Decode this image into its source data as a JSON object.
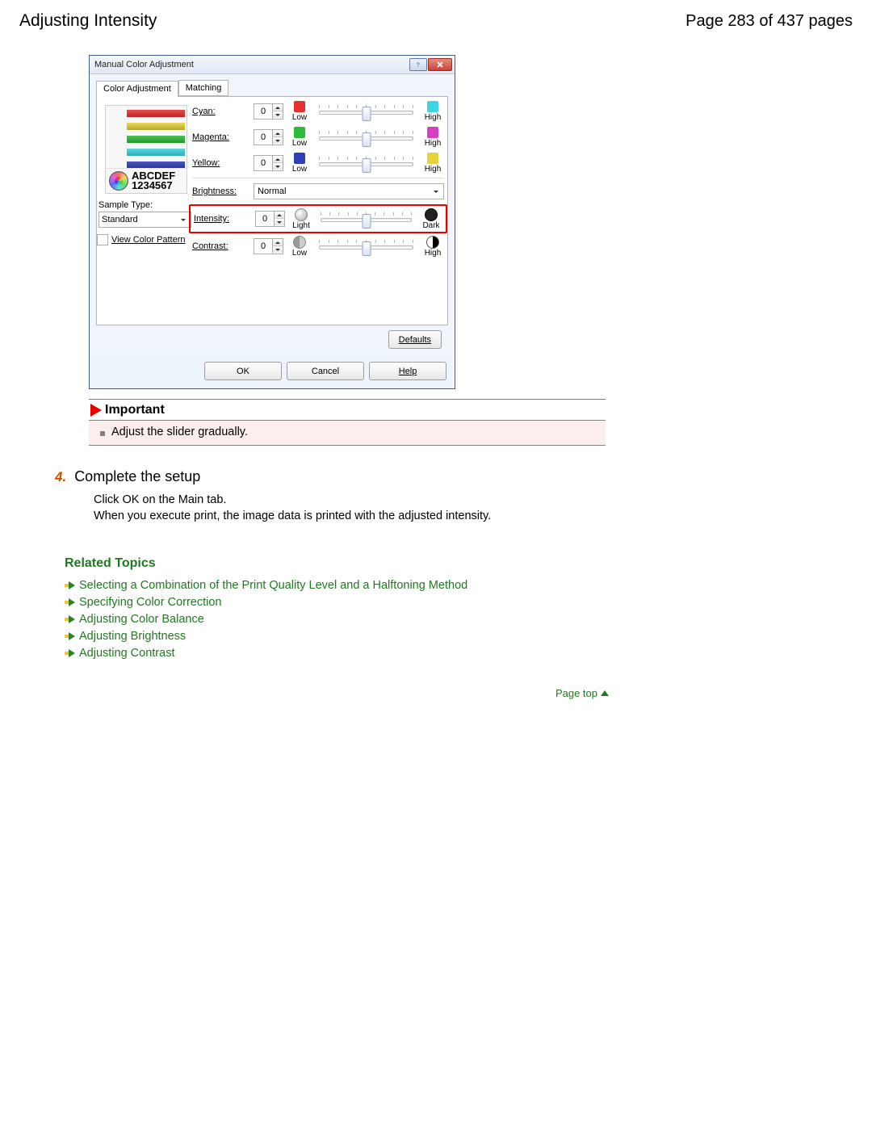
{
  "header": {
    "title": "Adjusting Intensity",
    "page_indicator": "Page 283 of 437 pages"
  },
  "dialog": {
    "title": "Manual Color Adjustment",
    "tabs": {
      "active": "Color Adjustment",
      "inactive": "Matching"
    },
    "preview": {
      "line1": "ABCDEF",
      "line2": "1234567"
    },
    "sample_type": {
      "label": "Sample Type:",
      "value": "Standard"
    },
    "view_pattern": {
      "label": "View Color Pattern"
    },
    "sliders": {
      "cyan": {
        "label": "Cyan:",
        "value": "0",
        "low": "Low",
        "high": "High",
        "low_color": "#e83030",
        "high_color": "#3dd5e0"
      },
      "magenta": {
        "label": "Magenta:",
        "value": "0",
        "low": "Low",
        "high": "High",
        "low_color": "#2fba3a",
        "high_color": "#d63fc0"
      },
      "yellow": {
        "label": "Yellow:",
        "value": "0",
        "low": "Low",
        "high": "High",
        "low_color": "#2f3fba",
        "high_color": "#e8d23a"
      },
      "brightness": {
        "label": "Brightness:",
        "value": "Normal"
      },
      "intensity": {
        "label": "Intensity:",
        "value": "0",
        "low": "Light",
        "high": "Dark"
      },
      "contrast": {
        "label": "Contrast:",
        "value": "0",
        "low": "Low",
        "high": "High"
      }
    },
    "buttons": {
      "defaults": "Defaults",
      "ok": "OK",
      "cancel": "Cancel",
      "help": "Help"
    }
  },
  "important": {
    "heading": "Important",
    "text": "Adjust the slider gradually."
  },
  "step": {
    "number": "4.",
    "title": "Complete the setup",
    "body_line1": "Click OK on the Main tab.",
    "body_line2": "When you execute print, the image data is printed with the adjusted intensity."
  },
  "related": {
    "heading": "Related Topics",
    "items": [
      "Selecting a Combination of the Print Quality Level and a Halftoning Method",
      "Specifying Color Correction",
      "Adjusting Color Balance",
      "Adjusting Brightness",
      "Adjusting Contrast"
    ]
  },
  "pagetop": {
    "label": "Page top"
  }
}
